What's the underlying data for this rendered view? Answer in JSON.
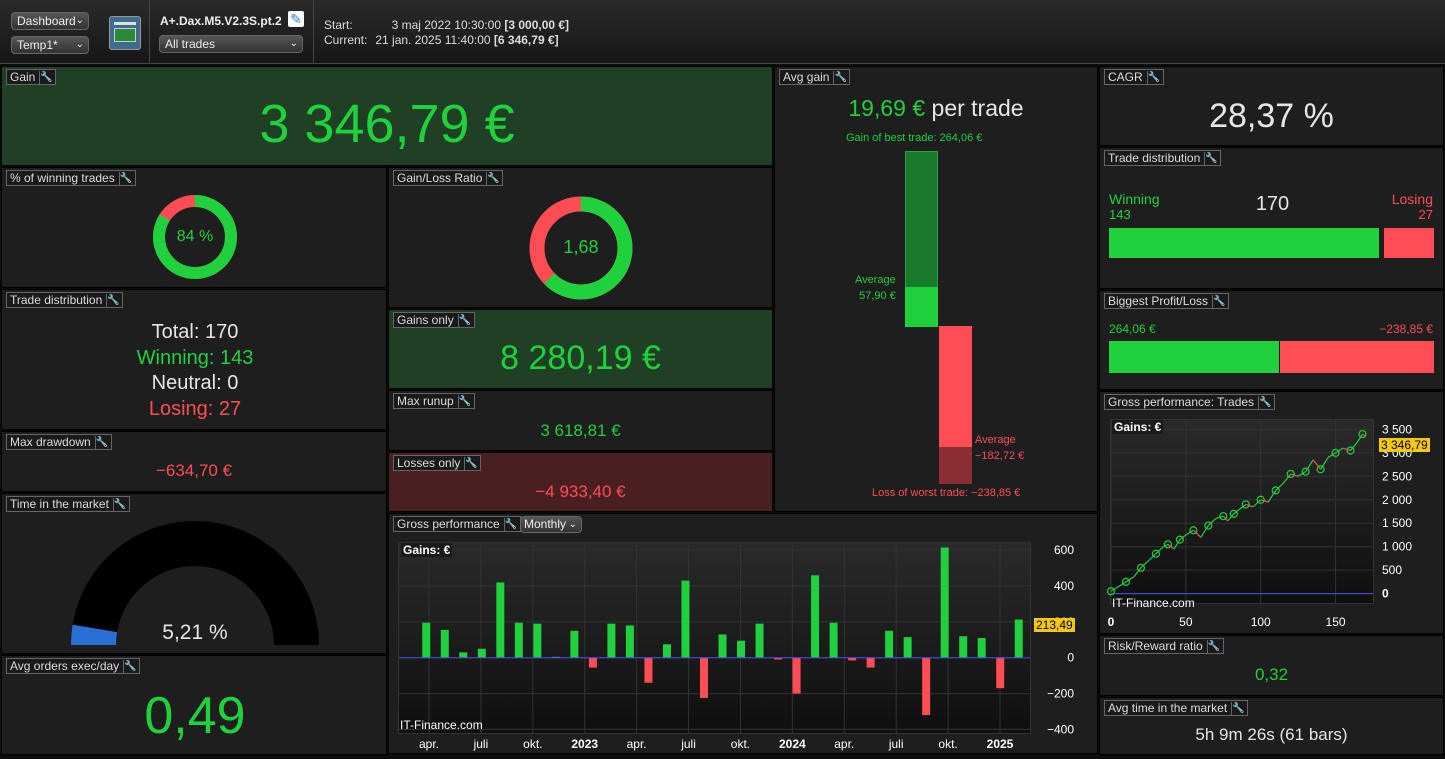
{
  "toolbar": {
    "view_select": "Dashboard",
    "template_select": "Temp1*",
    "strategy_name": "A+.Dax.M5.V2.3S.pt.2",
    "trades_filter": "All trades",
    "start_label": "Start:",
    "start_value": "3 maj 2022 10:30:00",
    "start_amount": "[3 000,00 €]",
    "current_label": "Current:",
    "current_value": "21 jan. 2025 11:40:00",
    "current_amount": "[6 346,79 €]"
  },
  "gain": {
    "title": "Gain",
    "value": "3 346,79 €"
  },
  "avg_gain": {
    "title": "Avg gain",
    "value": "19,69 €",
    "suffix": "per trade",
    "best_label": "Gain of best trade: 264,06 €",
    "avg_win_label": "Average",
    "avg_win_value": "57,90 €",
    "avg_loss_label": "Average",
    "avg_loss_value": "−182,72 €",
    "worst_label": "Loss of worst trade: −238,85 €",
    "best": 264.06,
    "avg_win": 57.9,
    "avg_loss": -182.72,
    "worst": -238.85
  },
  "cagr": {
    "title": "CAGR",
    "value": "28,37 %"
  },
  "pct_winning": {
    "title": "% of winning trades",
    "value": "84 %",
    "fraction": 0.84
  },
  "gain_loss_ratio": {
    "title": "Gain/Loss Ratio",
    "value": "1,68",
    "fraction": 0.627
  },
  "trade_dist_right": {
    "title": "Trade distribution",
    "winning_label": "Winning",
    "winning": "143",
    "total": "170",
    "losing_label": "Losing",
    "losing": "27",
    "win_fraction": 0.841
  },
  "trade_dist_left": {
    "title": "Trade distribution",
    "total": "Total: 170",
    "winning": "Winning: 143",
    "neutral": "Neutral: 0",
    "losing": "Losing: 27"
  },
  "gains_only": {
    "title": "Gains only",
    "value": "8 280,19 €"
  },
  "biggest": {
    "title": "Biggest Profit/Loss",
    "profit": "264,06 €",
    "loss": "−238,85 €",
    "profit_fraction": 0.525
  },
  "max_runup": {
    "title": "Max runup",
    "value": "3 618,81 €"
  },
  "max_drawdown": {
    "title": "Max drawdown",
    "value": "−634,70 €"
  },
  "losses_only": {
    "title": "Losses only",
    "value": "−4 933,40 €"
  },
  "time_market": {
    "title": "Time in the market",
    "value": "5,21 %",
    "fraction": 0.0521
  },
  "gross_trades": {
    "title": "Gross performance: Trades",
    "chart_label": "Gains: €",
    "watermark": "IT-Finance.com",
    "last_value": "3 346,79"
  },
  "gross_perf": {
    "title": "Gross performance",
    "period": "Monthly",
    "chart_label": "Gains: €",
    "watermark": "IT-Finance.com",
    "last_value": "213,49"
  },
  "risk_reward": {
    "title": "Risk/Reward ratio",
    "value": "0,32"
  },
  "avg_orders": {
    "title": "Avg orders exec/day",
    "value": "0,49"
  },
  "avg_time": {
    "title": "Avg time in the market",
    "value": "5h 9m 26s (61 bars)"
  },
  "chart_data": [
    {
      "type": "bar",
      "title": "Gross performance",
      "ylabel": "Gains: €",
      "x_tick_labels": [
        "apr.",
        "juli",
        "okt.",
        "2023",
        "apr.",
        "juli",
        "okt.",
        "2024",
        "apr.",
        "juli",
        "okt.",
        "2025"
      ],
      "y_tick_labels": [
        "600",
        "400",
        "200",
        "0",
        "−200",
        "−400"
      ],
      "ylim": [
        -420,
        640
      ],
      "values": [
        195,
        155,
        30,
        50,
        420,
        195,
        190,
        5,
        150,
        -55,
        190,
        180,
        -140,
        75,
        430,
        -225,
        130,
        95,
        190,
        -10,
        -200,
        460,
        195,
        -15,
        -55,
        150,
        115,
        -320,
        615,
        120,
        110,
        -170,
        213
      ],
      "colors": {
        "positive": "#1fd13c",
        "negative": "#ff4d55"
      }
    },
    {
      "type": "line",
      "title": "Gross performance: Trades",
      "ylabel": "Gains: €",
      "x_tick_labels": [
        "0",
        "50",
        "100",
        "150"
      ],
      "y_tick_labels": [
        "0",
        "500",
        "1 000",
        "1 500",
        "2 000",
        "2 500",
        "3 000",
        "3 500"
      ],
      "xlim": [
        0,
        175
      ],
      "ylim": [
        -200,
        3700
      ],
      "points": [
        [
          0,
          50
        ],
        [
          5,
          150
        ],
        [
          10,
          250
        ],
        [
          15,
          350
        ],
        [
          20,
          550
        ],
        [
          25,
          700
        ],
        [
          30,
          850
        ],
        [
          35,
          1000
        ],
        [
          38,
          1050
        ],
        [
          42,
          950
        ],
        [
          46,
          1150
        ],
        [
          50,
          1250
        ],
        [
          55,
          1350
        ],
        [
          60,
          1200
        ],
        [
          65,
          1450
        ],
        [
          70,
          1600
        ],
        [
          75,
          1650
        ],
        [
          78,
          1550
        ],
        [
          82,
          1700
        ],
        [
          86,
          1800
        ],
        [
          90,
          1900
        ],
        [
          95,
          1850
        ],
        [
          100,
          2000
        ],
        [
          105,
          1950
        ],
        [
          110,
          2200
        ],
        [
          115,
          2350
        ],
        [
          120,
          2550
        ],
        [
          125,
          2500
        ],
        [
          130,
          2600
        ],
        [
          135,
          2850
        ],
        [
          140,
          2650
        ],
        [
          145,
          2900
        ],
        [
          150,
          3000
        ],
        [
          155,
          3100
        ],
        [
          160,
          3050
        ],
        [
          165,
          3250
        ],
        [
          168,
          3400
        ],
        [
          170,
          3346.79
        ]
      ]
    }
  ]
}
